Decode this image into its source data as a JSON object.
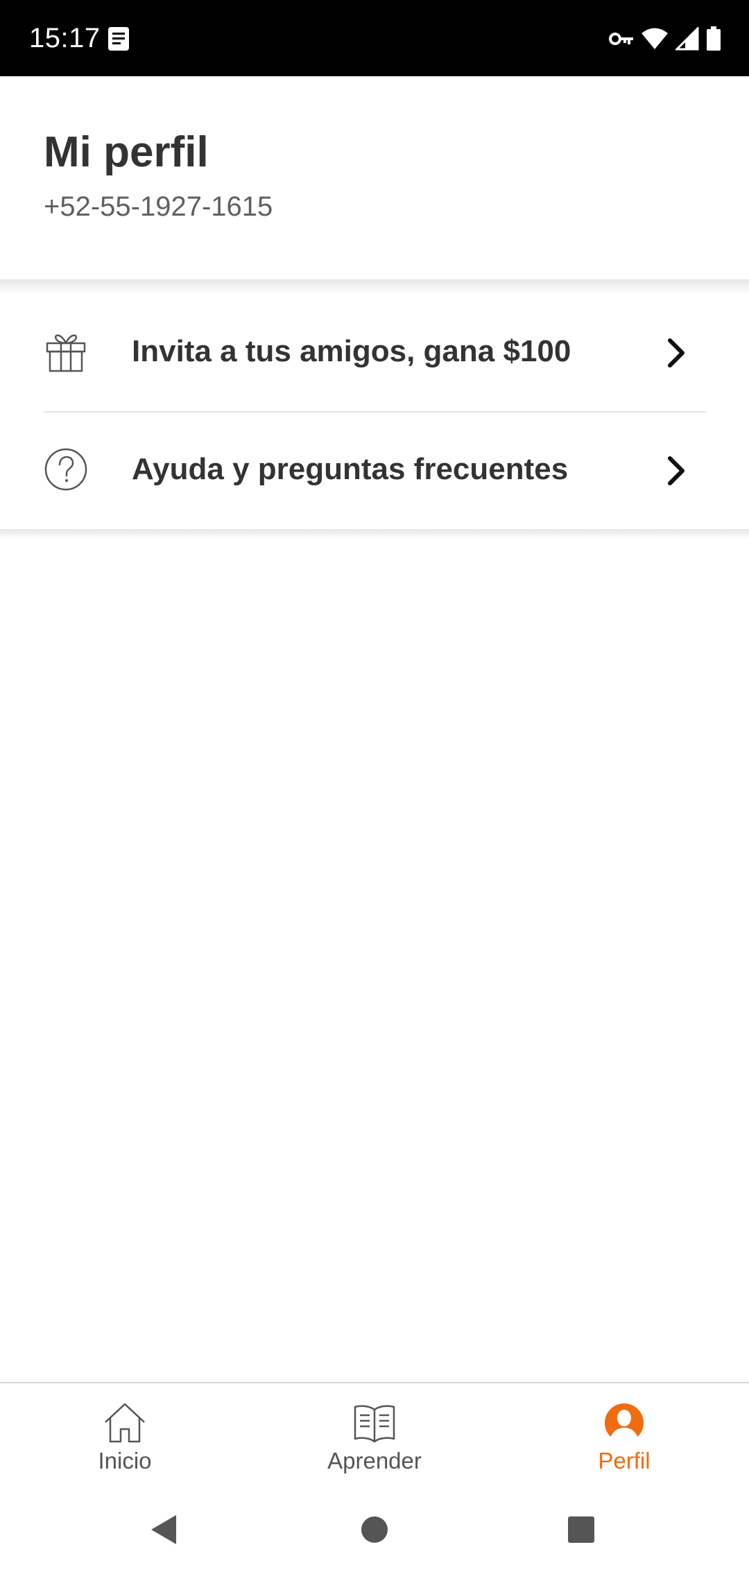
{
  "status_bar": {
    "time": "15:17",
    "icons": [
      "notification-note-icon",
      "vpn-key-icon",
      "wifi-icon",
      "signal-icon",
      "battery-icon"
    ]
  },
  "header": {
    "title": "Mi perfil",
    "phone": "+52-55-1927-1615"
  },
  "menu": {
    "items": [
      {
        "label": "Invita a tus amigos, gana $100",
        "icon": "gift-icon"
      },
      {
        "label": "Ayuda y preguntas frecuentes",
        "icon": "help-circle-icon"
      }
    ]
  },
  "bottom_nav": {
    "items": [
      {
        "label": "Inicio",
        "icon": "home-icon",
        "active": false
      },
      {
        "label": "Aprender",
        "icon": "book-icon",
        "active": false
      },
      {
        "label": "Perfil",
        "icon": "profile-icon",
        "active": true
      }
    ]
  },
  "colors": {
    "accent": "#f06c0f",
    "text_primary": "#333333",
    "text_secondary": "#5f5f5f",
    "status_bar": "#000000"
  }
}
